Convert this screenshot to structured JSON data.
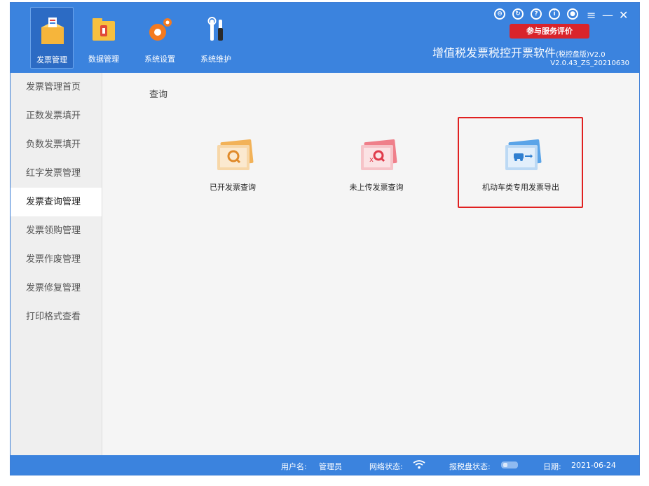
{
  "toolbar": {
    "items": [
      {
        "label": "发票管理",
        "icon": "invoice-box-icon",
        "active": true
      },
      {
        "label": "数据管理",
        "icon": "folder-data-icon",
        "active": false
      },
      {
        "label": "系统设置",
        "icon": "gear-icon",
        "active": false
      },
      {
        "label": "系统维护",
        "icon": "tools-icon",
        "active": false
      }
    ]
  },
  "header": {
    "feedback_button": "参与服务评价",
    "title": "增值税发票税控开票软件",
    "edition": "(税控盘版)V2.0",
    "version": "V2.0.43_ZS_20210630"
  },
  "sidebar": {
    "items": [
      {
        "label": "发票管理首页"
      },
      {
        "label": "正数发票填开"
      },
      {
        "label": "负数发票填开"
      },
      {
        "label": "红字发票管理"
      },
      {
        "label": "发票查询管理"
      },
      {
        "label": "发票领购管理"
      },
      {
        "label": "发票作废管理"
      },
      {
        "label": "发票修复管理"
      },
      {
        "label": "打印格式查看"
      }
    ],
    "active_index": 4
  },
  "main": {
    "section_title": "查询",
    "functions": [
      {
        "label": "已开发票查询",
        "icon": "invoice-search-icon"
      },
      {
        "label": "未上传发票查询",
        "icon": "invoice-unuploaded-search-icon"
      },
      {
        "label": "机动车类专用发票导出",
        "icon": "vehicle-invoice-export-icon"
      }
    ]
  },
  "status": {
    "user_label": "用户名:",
    "user_value": "管理员",
    "network_label": "网络状态:",
    "disk_label": "报税盘状态:",
    "date_label": "日期:",
    "date_value": "2021-06-24"
  },
  "colors": {
    "header_blue": "#3b83de",
    "highlight_red": "#e02020",
    "feedback_red": "#d9242b"
  }
}
